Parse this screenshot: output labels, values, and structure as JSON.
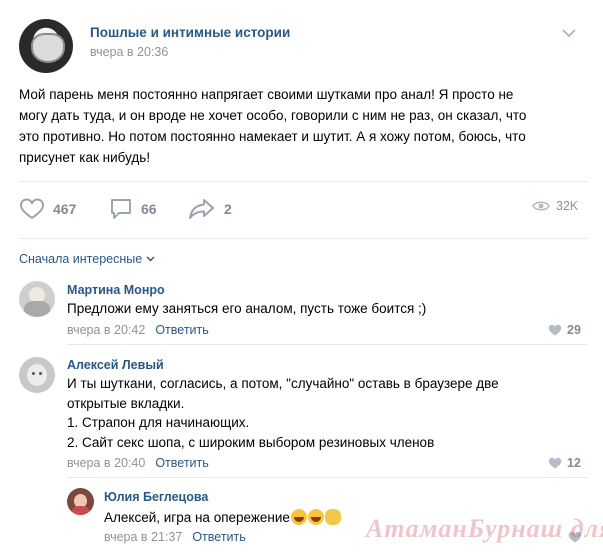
{
  "post": {
    "group_name": "Пошлые и интимные истории",
    "time": "вчера в 20:36",
    "text_lines": [
      "Мой парень меня постоянно напрягает своими шутками про анал! Я просто не",
      "могу дать туда, и он вроде не хочет особо, говорили с ним не раз, он сказал, что",
      "это противно. Но потом постоянно намекает и шутит. А я хожу потом, боюсь, что",
      "присунет как нибудь!"
    ],
    "likes": "467",
    "comments": "66",
    "shares": "2",
    "views": "32K"
  },
  "sort_label": "Сначала интересные",
  "comments": [
    {
      "author": "Мартина Монро",
      "lines": [
        "Предложи ему заняться его аналом, пусть тоже боится ;)"
      ],
      "time": "вчера в 20:42",
      "reply_label": "Ответить",
      "likes": "29"
    },
    {
      "author": "Алексей Левый",
      "lines": [
        "И ты шуткани, согласись, а потом, \"случайно\" оставь в браузере две",
        "открытые вкладки.",
        "1. Страпон для начинающих.",
        "2. Сайт секс шопа, с широким выбором резиновых членов"
      ],
      "time": "вчера в 20:40",
      "reply_label": "Ответить",
      "likes": "12"
    },
    {
      "author": "Юлия Беглецова",
      "text": "Алексей, игра на опережение",
      "time": "вчера в 21:37",
      "reply_label": "Ответить"
    }
  ],
  "watermark": "АтаманБурнаш для ЯП",
  "colors": {
    "link": "#2a5885",
    "meta": "#939393",
    "icon": "#828a99",
    "separator": "#e7e8ec"
  }
}
